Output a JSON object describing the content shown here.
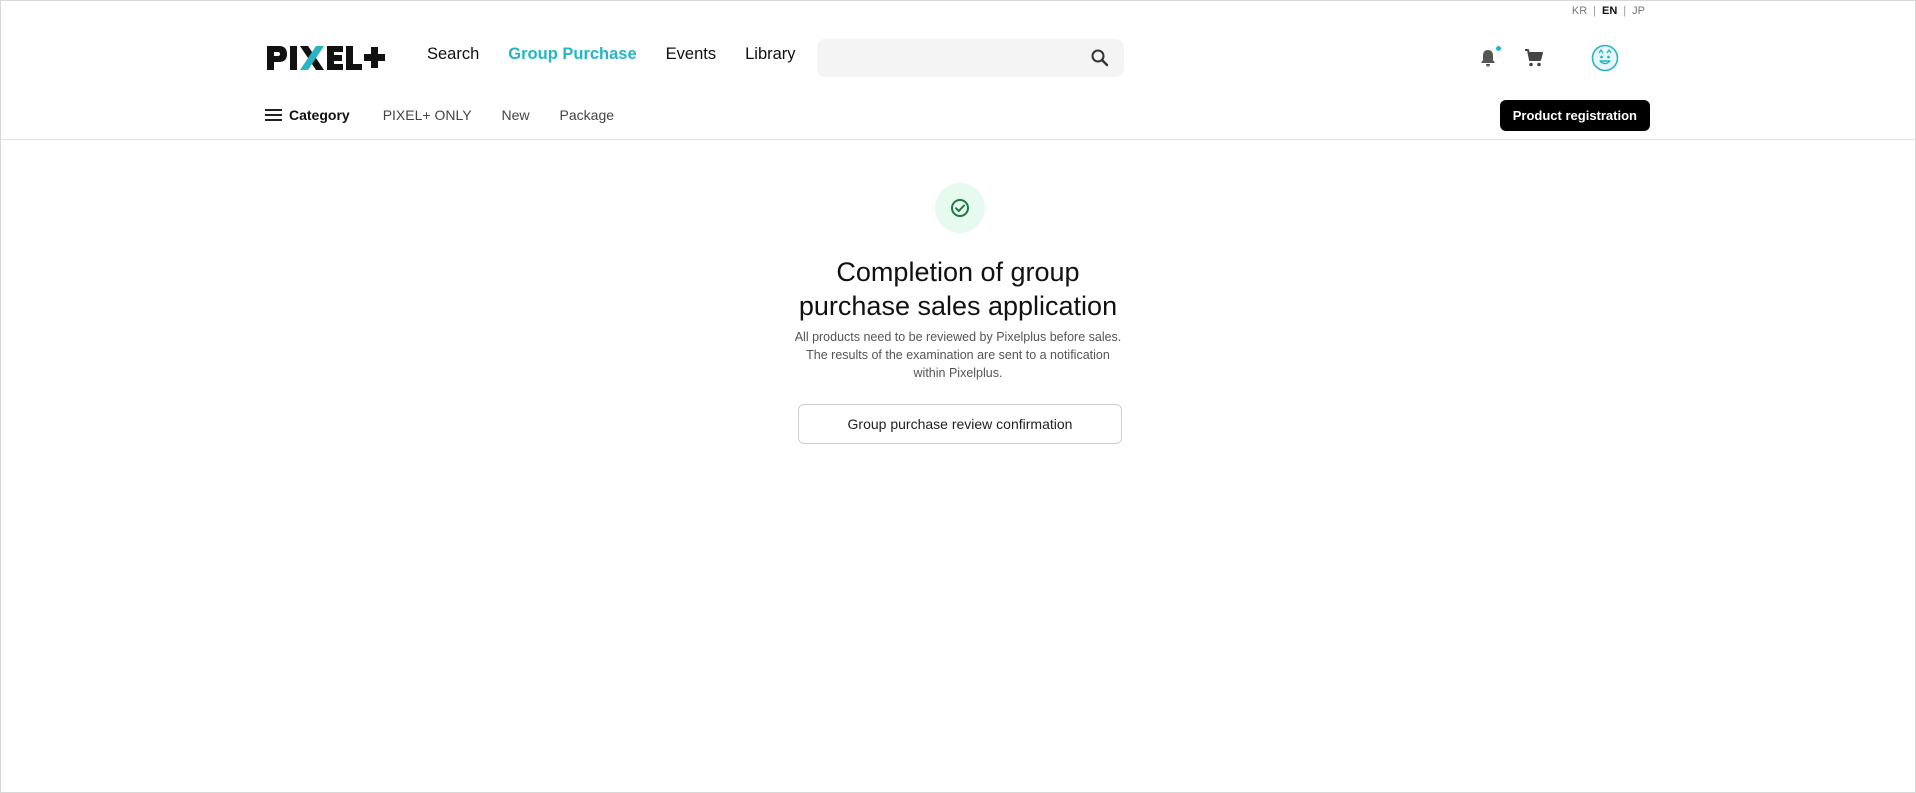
{
  "languages": [
    {
      "code": "KR",
      "active": false
    },
    {
      "code": "EN",
      "active": true
    },
    {
      "code": "JP",
      "active": false
    }
  ],
  "language_separator": "|",
  "brand": {
    "name": "PIXEL+",
    "accent": "#27b4c4"
  },
  "main_nav": [
    {
      "label": "Search",
      "active": false
    },
    {
      "label": "Group Purchase",
      "active": true
    },
    {
      "label": "Events",
      "active": false
    },
    {
      "label": "Library",
      "active": false
    }
  ],
  "search": {
    "placeholder": "",
    "value": "",
    "icon": "search-icon"
  },
  "header_icons": {
    "notification": "bell-icon",
    "cart": "cart-icon",
    "avatar": "avatar-icon"
  },
  "sub_nav": {
    "category_label": "Category",
    "items": [
      "PIXEL+ ONLY",
      "New",
      "Package"
    ]
  },
  "register_button": "Product registration",
  "completion": {
    "icon": "check-circle-icon",
    "title": "Completion of group purchase sales application",
    "desc_line1": "All products need to be reviewed by Pixelplus before sales.",
    "desc_line2": "The results of the examination are sent to a notification within Pixelplus.",
    "confirm_button": "Group purchase review confirmation",
    "success_color": "#1aa260"
  }
}
